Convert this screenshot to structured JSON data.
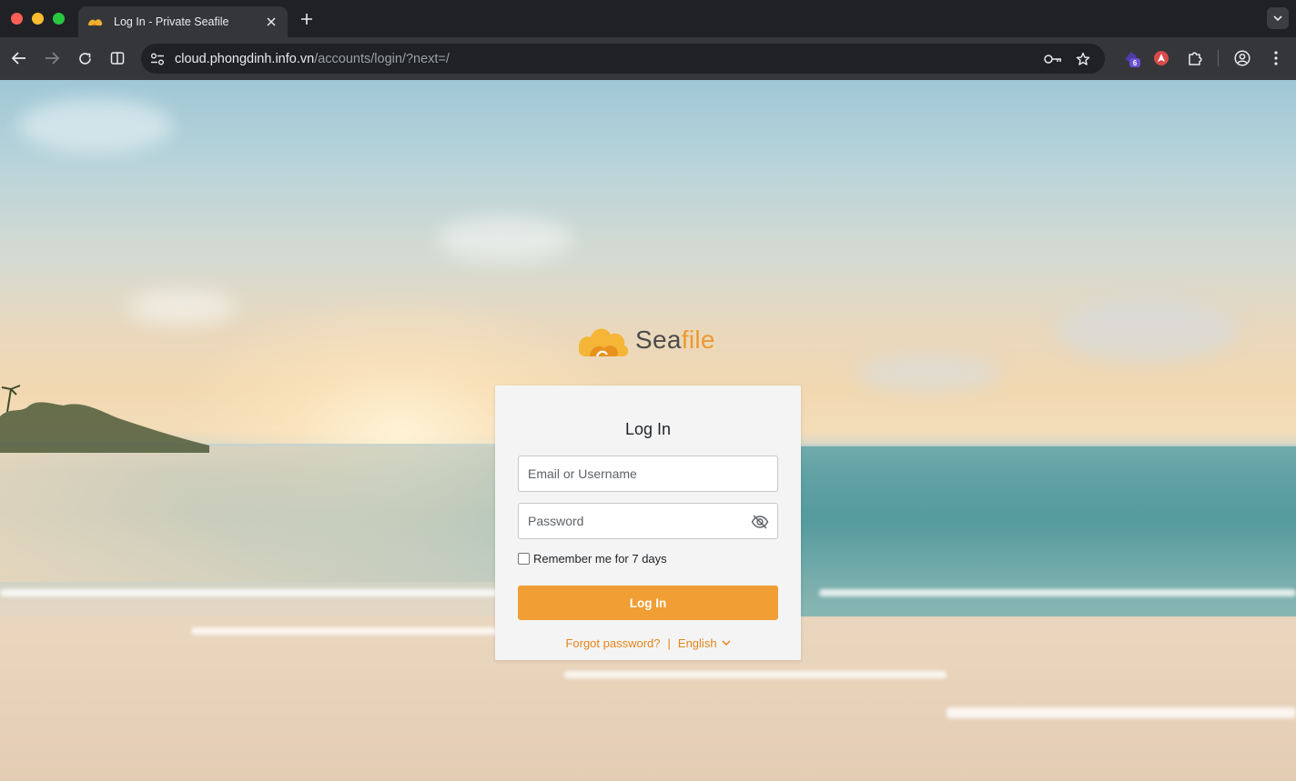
{
  "browser": {
    "tab_title": "Log In - Private Seafile",
    "url_host": "cloud.phongdinh.info.vn",
    "url_path": "/accounts/login/?next=/",
    "extension_badge": "6"
  },
  "logo": {
    "prefix": "Sea",
    "suffix": "file"
  },
  "login": {
    "title": "Log In",
    "username_placeholder": "Email or Username",
    "password_placeholder": "Password",
    "remember_label": "Remember me for 7 days",
    "submit_label": "Log In",
    "forgot_label": "Forgot password?",
    "separator": "|",
    "language": "English"
  },
  "colors": {
    "accent": "#f19e35",
    "link": "#e3851c"
  }
}
